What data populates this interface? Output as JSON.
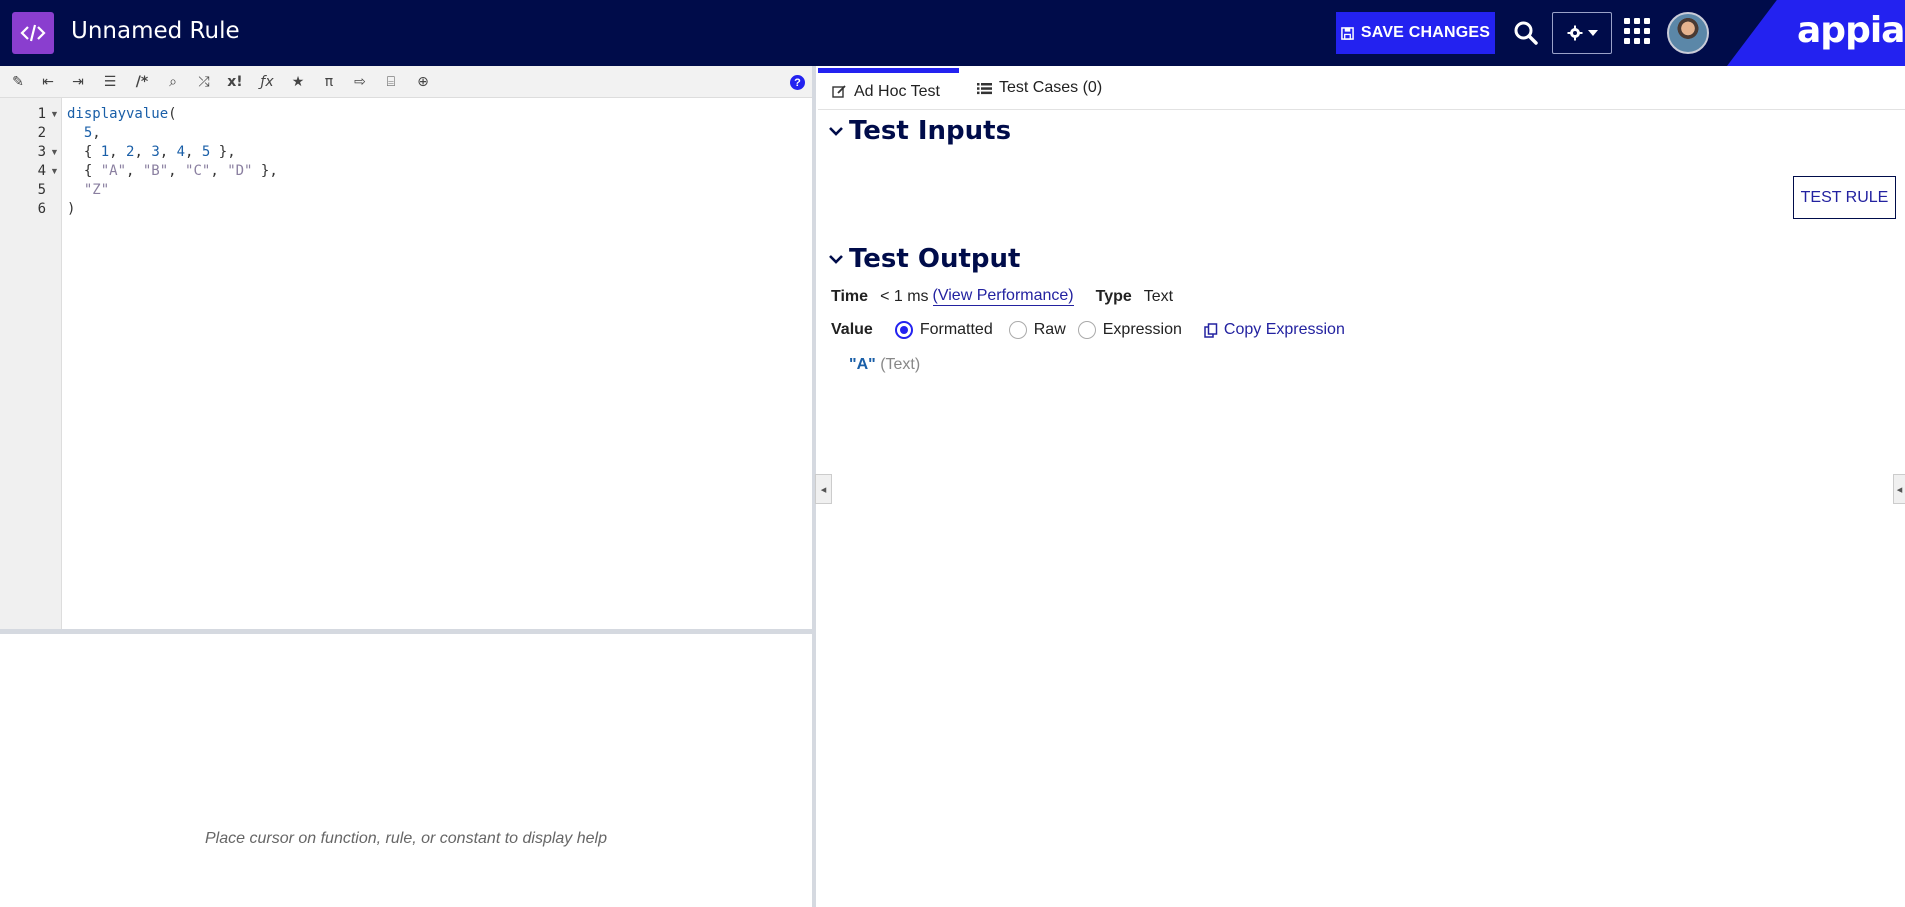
{
  "header": {
    "title": "Unnamed Rule",
    "save_label": "SAVE CHANGES",
    "logo": "appian"
  },
  "editor": {
    "toolbar_icons": [
      "format-icon",
      "outdent-icon",
      "indent-icon",
      "list-icon",
      "comment-icon",
      "search-icon",
      "shuffle-icon",
      "factorial-icon",
      "function-icon",
      "star-icon",
      "pi-icon",
      "export-icon",
      "query-icon",
      "globe-icon"
    ],
    "help_label": "?",
    "line_numbers": [
      "1",
      "2",
      "3",
      "4",
      "5",
      "6"
    ],
    "code": {
      "l1_fn": "displayvalue",
      "l1_paren": "(",
      "l2": "5",
      "l3_nums": [
        "1",
        "2",
        "3",
        "4",
        "5"
      ],
      "l4_strs": [
        "\"A\"",
        "\"B\"",
        "\"C\"",
        "\"D\""
      ],
      "l5": "\"Z\"",
      "l6": ")"
    },
    "help_text": "Place cursor on function, rule, or constant to display help"
  },
  "tabs": {
    "adhoc": "Ad Hoc Test",
    "cases": "Test Cases (0)"
  },
  "test_inputs": {
    "heading": "Test Inputs",
    "test_rule_label": "TEST RULE"
  },
  "test_output": {
    "heading": "Test Output",
    "time_label": "Time",
    "time_value": "< 1 ms",
    "view_perf": "(View Performance)",
    "type_label": "Type",
    "type_value": "Text",
    "value_label": "Value",
    "options": [
      "Formatted",
      "Raw",
      "Expression"
    ],
    "selected": "Formatted",
    "copy_label": "Copy Expression",
    "result_value": "\"A\"",
    "result_type": "(Text)"
  },
  "colors": {
    "header_bg": "#000c4a",
    "accent": "#2322f0",
    "rule_icon": "#8a3ecf"
  }
}
